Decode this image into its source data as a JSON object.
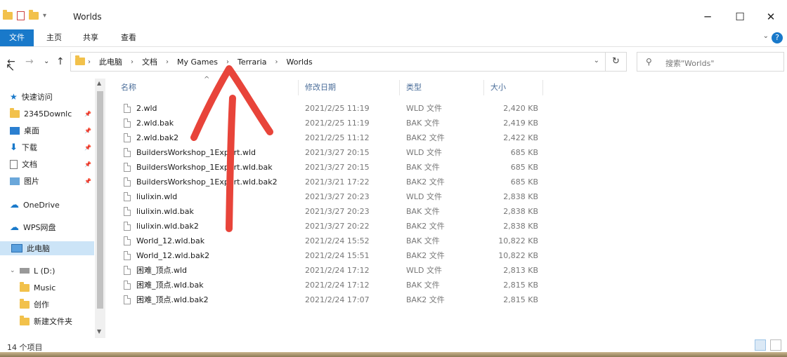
{
  "window": {
    "title": "Worlds",
    "buttons": {
      "minimize": "─",
      "maximize": "☐",
      "close": "✕"
    }
  },
  "ribbon": {
    "tabs": [
      "文件",
      "主页",
      "共享",
      "查看"
    ],
    "help": "?",
    "expand": "⌄"
  },
  "nav": {
    "back": "←",
    "forward": "→",
    "recent": "⌄",
    "up": "↑",
    "refresh": "↻"
  },
  "address": {
    "crumbs": [
      "此电脑",
      "文档",
      "My Games",
      "Terraria",
      "Worlds"
    ],
    "separator": "›",
    "dropdown": "⌄"
  },
  "search": {
    "placeholder": "搜索\"Worlds\""
  },
  "sidebar": {
    "items": [
      {
        "label": "快速访问",
        "icon": "star-icon"
      },
      {
        "label": "2345Downlc",
        "icon": "folder-icon"
      },
      {
        "label": "桌面",
        "icon": "desktop-icon"
      },
      {
        "label": "下载",
        "icon": "download-icon"
      },
      {
        "label": "文档",
        "icon": "documents-icon"
      },
      {
        "label": "图片",
        "icon": "pictures-icon"
      },
      {
        "label": "OneDrive",
        "icon": "cloud-icon"
      },
      {
        "label": "WPS网盘",
        "icon": "cloud-icon"
      },
      {
        "label": "此电脑",
        "icon": "computer-icon"
      },
      {
        "label": "L (D:)",
        "icon": "drive-icon"
      },
      {
        "label": "Music",
        "icon": "folder-icon"
      },
      {
        "label": "创作",
        "icon": "folder-icon"
      },
      {
        "label": "新建文件夹",
        "icon": "folder-icon"
      }
    ]
  },
  "filelist": {
    "columns": {
      "name": "名称",
      "date": "修改日期",
      "type": "类型",
      "size": "大小"
    },
    "rows": [
      {
        "name": "2.wld",
        "date": "2021/2/25 11:19",
        "type": "WLD 文件",
        "size": "2,420 KB"
      },
      {
        "name": "2.wld.bak",
        "date": "2021/2/25 11:19",
        "type": "BAK 文件",
        "size": "2,419 KB"
      },
      {
        "name": "2.wld.bak2",
        "date": "2021/2/25 11:12",
        "type": "BAK2 文件",
        "size": "2,422 KB"
      },
      {
        "name": "BuildersWorkshop_1Expert.wld",
        "date": "2021/3/27 20:15",
        "type": "WLD 文件",
        "size": "685 KB"
      },
      {
        "name": "BuildersWorkshop_1Expert.wld.bak",
        "date": "2021/3/27 20:15",
        "type": "BAK 文件",
        "size": "685 KB"
      },
      {
        "name": "BuildersWorkshop_1Expert.wld.bak2",
        "date": "2021/3/21 17:22",
        "type": "BAK2 文件",
        "size": "685 KB"
      },
      {
        "name": "liulixin.wld",
        "date": "2021/3/27 20:23",
        "type": "WLD 文件",
        "size": "2,838 KB"
      },
      {
        "name": "liulixin.wld.bak",
        "date": "2021/3/27 20:23",
        "type": "BAK 文件",
        "size": "2,838 KB"
      },
      {
        "name": "liulixin.wld.bak2",
        "date": "2021/3/27 20:22",
        "type": "BAK2 文件",
        "size": "2,838 KB"
      },
      {
        "name": "World_12.wld.bak",
        "date": "2021/2/24 15:52",
        "type": "BAK 文件",
        "size": "10,822 KB"
      },
      {
        "name": "World_12.wld.bak2",
        "date": "2021/2/24 15:51",
        "type": "BAK2 文件",
        "size": "10,822 KB"
      },
      {
        "name": "困难_顶点.wld",
        "date": "2021/2/24 17:12",
        "type": "WLD 文件",
        "size": "2,813 KB"
      },
      {
        "name": "困难_顶点.wld.bak",
        "date": "2021/2/24 17:12",
        "type": "BAK 文件",
        "size": "2,815 KB"
      },
      {
        "name": "困难_顶点.wld.bak2",
        "date": "2021/2/24 17:07",
        "type": "BAK2 文件",
        "size": "2,815 KB"
      }
    ]
  },
  "status": {
    "item_count": "14 个项目"
  },
  "colors": {
    "accent": "#1979ca",
    "annotation": "#e8443a",
    "folder": "#f2c14b"
  }
}
